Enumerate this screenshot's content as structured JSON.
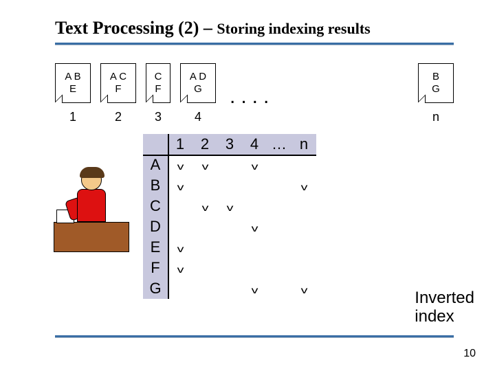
{
  "title_main": "Text Processing (2)",
  "title_sep": " – ",
  "title_sub": "Storing indexing results",
  "docs": [
    {
      "lines": [
        "A  B",
        "E"
      ],
      "label": "1"
    },
    {
      "lines": [
        "A  C",
        "F"
      ],
      "label": "2"
    },
    {
      "lines": [
        "C",
        "F"
      ],
      "label": "3",
      "small": true
    },
    {
      "lines": [
        "A  D",
        "G"
      ],
      "label": "4"
    }
  ],
  "ellipsis": "....",
  "doc_last": {
    "lines": [
      "B",
      "G"
    ],
    "label": "n"
  },
  "matrix": {
    "cols": [
      "1",
      "2",
      "3",
      "4",
      "…",
      "n"
    ],
    "rows": [
      "A",
      "B",
      "C",
      "D",
      "E",
      "F",
      "G"
    ],
    "cells": {
      "A": {
        "1": "v",
        "2": "v",
        "4": "v"
      },
      "B": {
        "1": "v",
        "n": "v"
      },
      "C": {
        "2": "v",
        "3": "v"
      },
      "D": {
        "4": "v"
      },
      "E": {
        "1": "v"
      },
      "F": {
        "1": "v"
      },
      "G": {
        "4": "v",
        "n": "v"
      }
    }
  },
  "label_inverted_l1": "Inverted",
  "label_inverted_l2": "index",
  "page_number": "10",
  "chart_data": {
    "type": "table",
    "title": "Inverted index (term-document incidence matrix)",
    "columns": [
      "1",
      "2",
      "3",
      "4",
      "…",
      "n"
    ],
    "rows": [
      "A",
      "B",
      "C",
      "D",
      "E",
      "F",
      "G"
    ],
    "values": [
      [
        1,
        1,
        0,
        1,
        null,
        0
      ],
      [
        1,
        0,
        0,
        0,
        null,
        1
      ],
      [
        0,
        1,
        1,
        0,
        null,
        0
      ],
      [
        0,
        0,
        0,
        1,
        null,
        0
      ],
      [
        1,
        0,
        0,
        0,
        null,
        0
      ],
      [
        1,
        0,
        0,
        0,
        null,
        0
      ],
      [
        0,
        0,
        0,
        1,
        null,
        1
      ]
    ],
    "documents": {
      "1": [
        "A",
        "B",
        "E"
      ],
      "2": [
        "A",
        "C",
        "F"
      ],
      "3": [
        "C",
        "F"
      ],
      "4": [
        "A",
        "D",
        "G"
      ],
      "n": [
        "B",
        "G"
      ]
    }
  }
}
